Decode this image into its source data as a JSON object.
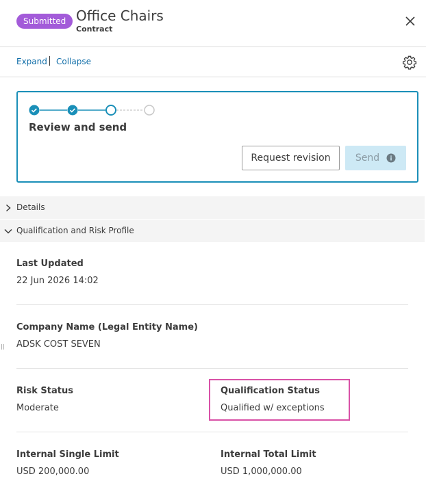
{
  "header": {
    "badge": "Submitted",
    "title": "Office Chairs",
    "subtitle": "Contract"
  },
  "toolbar": {
    "expand": "Expand",
    "collapse": "Collapse"
  },
  "stepper": {
    "step_title": "Review and send",
    "steps_total": 4,
    "steps_completed": 2,
    "current_step": 3,
    "request_revision_label": "Request revision",
    "send_label": "Send"
  },
  "sections": {
    "details": "Details",
    "qualification": "Qualification and Risk Profile"
  },
  "fields": {
    "last_updated": {
      "label": "Last Updated",
      "value": "22 Jun 2026 14:02"
    },
    "company_name": {
      "label": "Company Name (Legal Entity Name)",
      "value": "ADSK COST SEVEN"
    },
    "risk_status": {
      "label": "Risk Status",
      "value": "Moderate"
    },
    "qualification_status": {
      "label": "Qualification Status",
      "value": "Qualified w/ exceptions"
    },
    "internal_single_limit": {
      "label": "Internal Single Limit",
      "value": "USD 200,000.00"
    },
    "internal_total_limit": {
      "label": "Internal Total Limit",
      "value": "USD 1,000,000.00"
    }
  },
  "colors": {
    "badge": "#a35bd9",
    "accent": "#1a8fb8",
    "link": "#0f6da8",
    "highlight": "#d952a7",
    "send_disabled_bg": "#cde9f5"
  },
  "icons": {
    "close": "close-icon",
    "settings": "gear-icon",
    "info": "info-icon",
    "chevron_right": "chevron-right-icon",
    "chevron_down": "chevron-down-icon"
  }
}
